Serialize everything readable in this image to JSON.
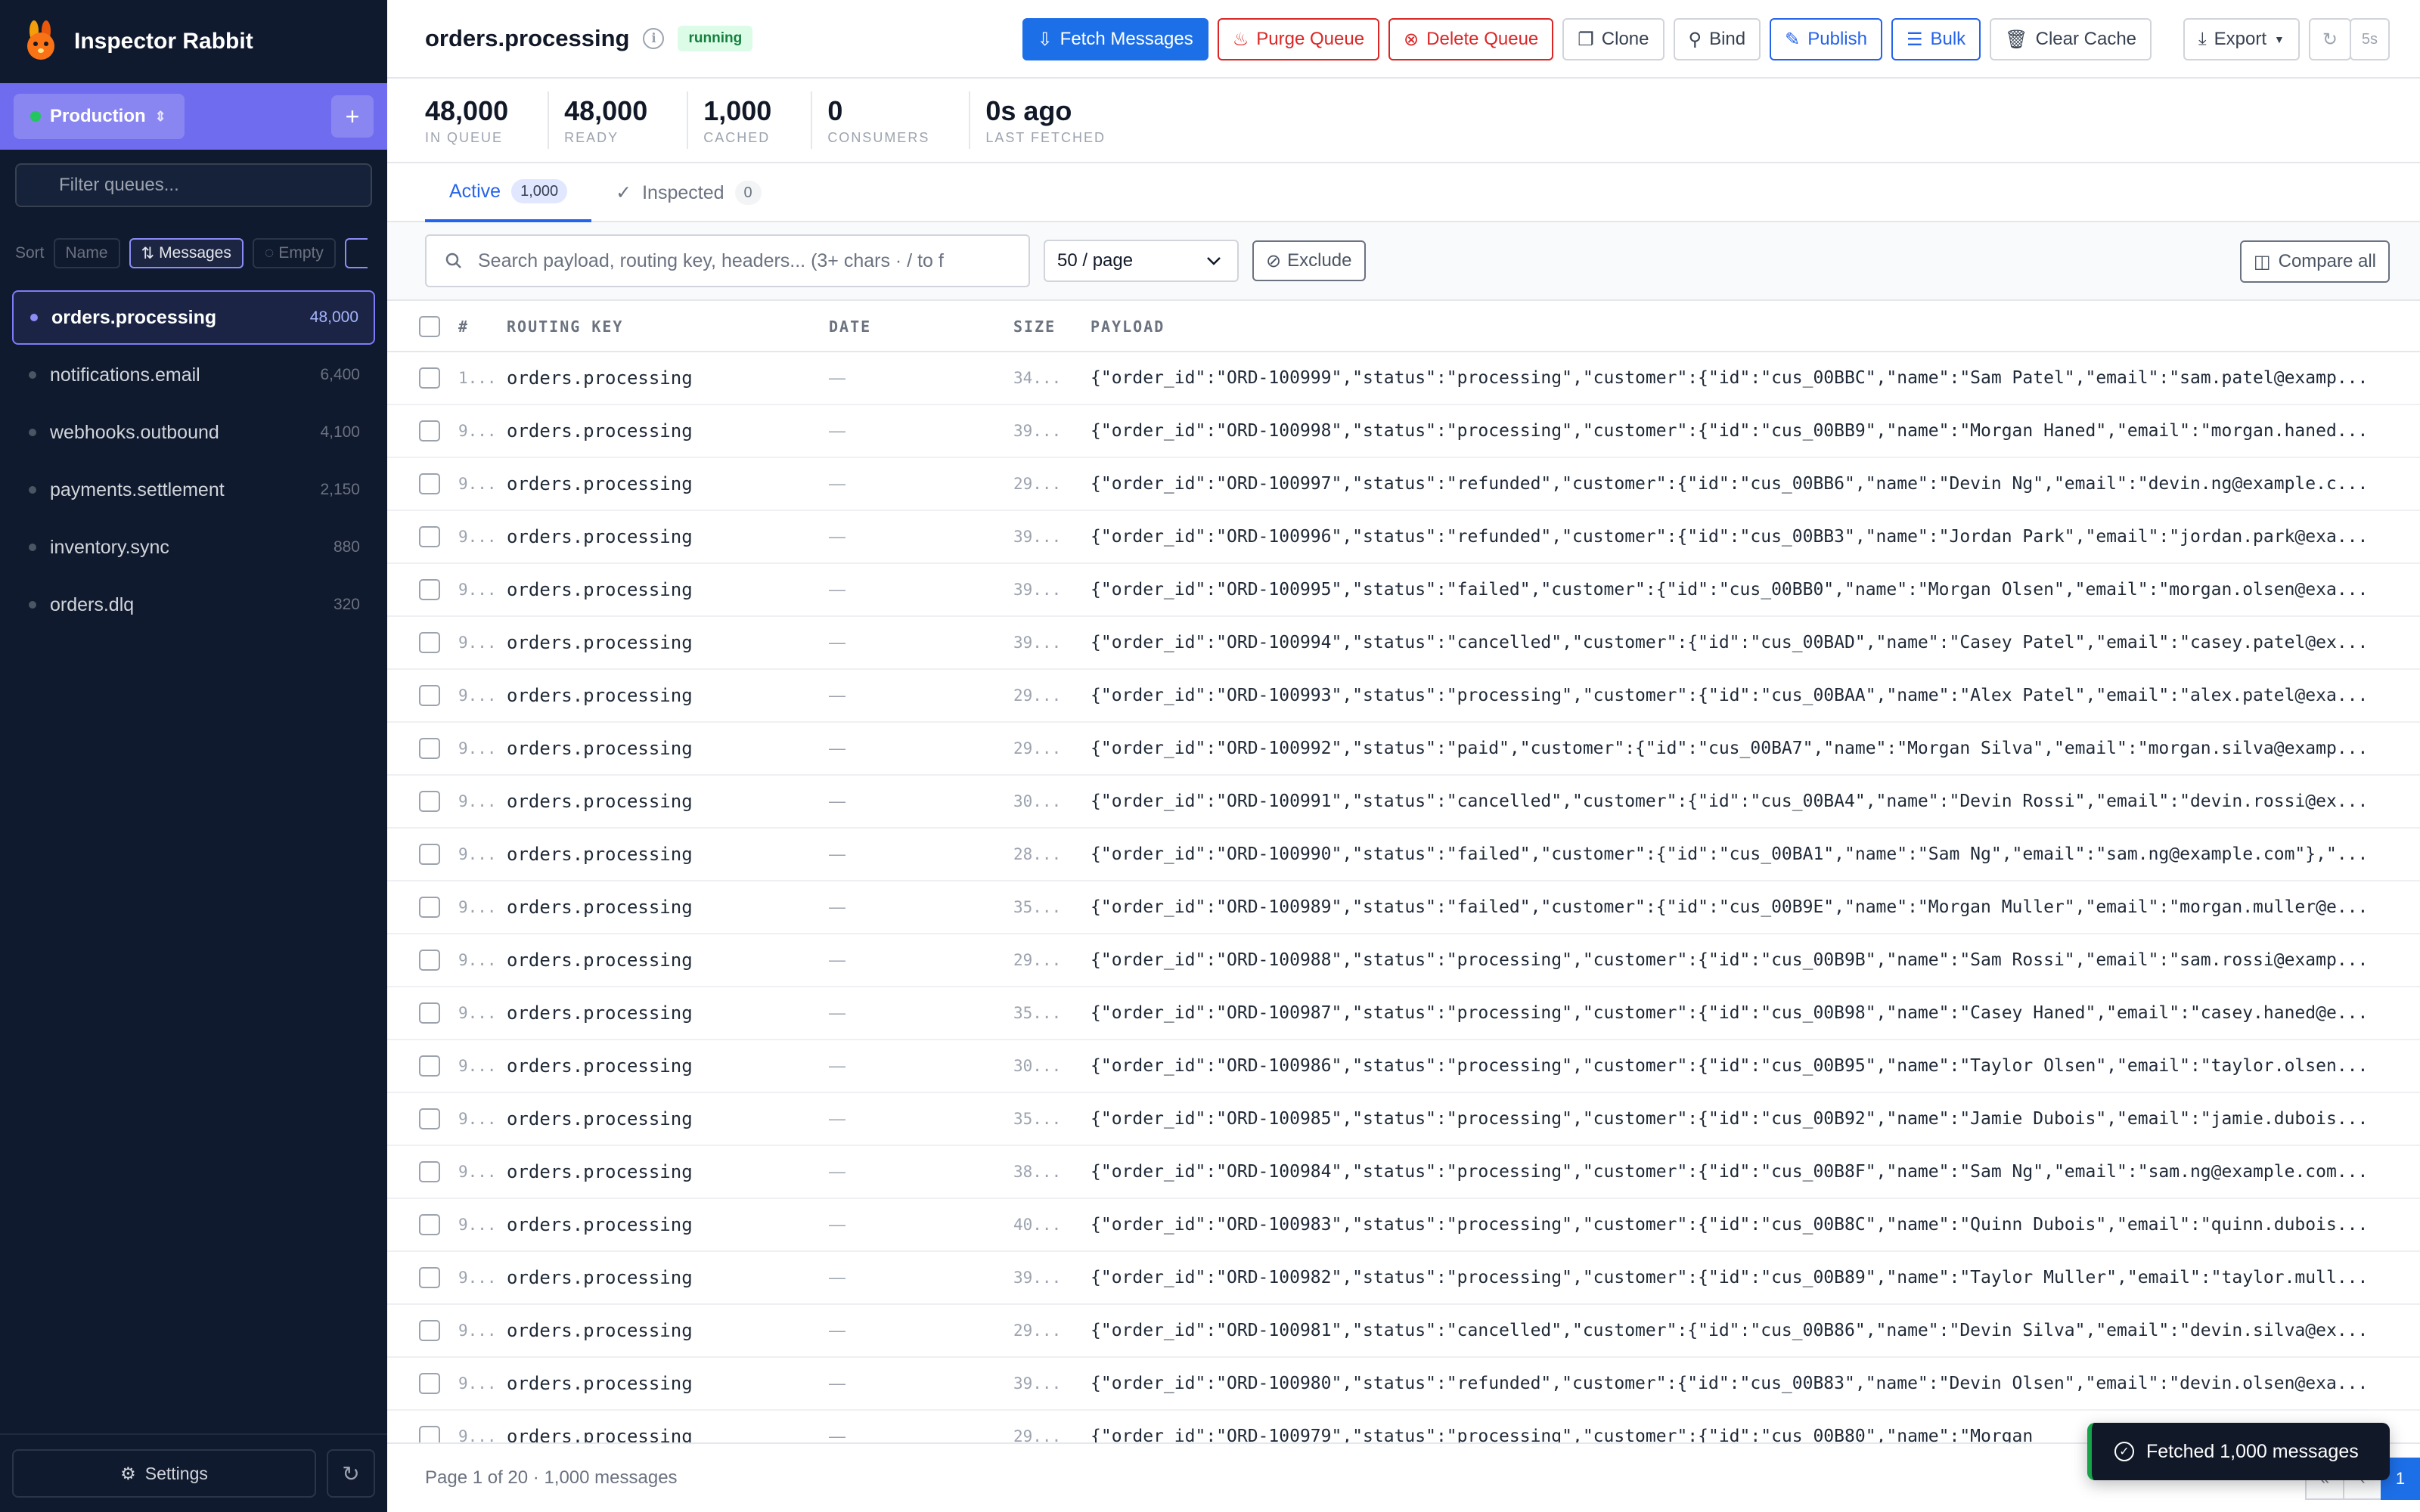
{
  "app": {
    "title": "Inspector Rabbit"
  },
  "sidebar": {
    "environment": "Production",
    "filter_placeholder": "Filter queues...",
    "sort_label": "Sort",
    "sort_options": [
      "Name",
      "Messages",
      "Empty"
    ],
    "queues": [
      {
        "name": "orders.processing",
        "count": "48,000"
      },
      {
        "name": "notifications.email",
        "count": "6,400"
      },
      {
        "name": "webhooks.outbound",
        "count": "4,100"
      },
      {
        "name": "payments.settlement",
        "count": "2,150"
      },
      {
        "name": "inventory.sync",
        "count": "880"
      },
      {
        "name": "orders.dlq",
        "count": "320"
      }
    ],
    "settings_label": "Settings"
  },
  "header": {
    "queue_title": "orders.processing",
    "status": "running",
    "buttons": {
      "fetch": "Fetch Messages",
      "purge": "Purge Queue",
      "delete": "Delete Queue",
      "clone": "Clone",
      "bind": "Bind",
      "publish": "Publish",
      "bulk": "Bulk",
      "clear_cache": "Clear Cache",
      "export": "Export",
      "interval": "5s"
    }
  },
  "stats": [
    {
      "value": "48,000",
      "label": "IN QUEUE"
    },
    {
      "value": "48,000",
      "label": "READY"
    },
    {
      "value": "1,000",
      "label": "CACHED"
    },
    {
      "value": "0",
      "label": "CONSUMERS"
    },
    {
      "value": "0s ago",
      "label": "LAST FETCHED"
    }
  ],
  "tabs": [
    {
      "label": "Active",
      "count": "1,000"
    },
    {
      "label": "Inspected",
      "count": "0"
    }
  ],
  "filters": {
    "search_placeholder": "Search payload, routing key, headers... (3+ chars · / to f",
    "page_size": "50 / page",
    "exclude": "Exclude",
    "compare": "Compare all"
  },
  "table": {
    "headers": {
      "num": "#",
      "routing_key": "ROUTING KEY",
      "date": "DATE",
      "size": "SIZE",
      "payload": "PAYLOAD"
    },
    "rows": [
      {
        "num": "1...",
        "rk": "orders.processing",
        "date": "—",
        "size": "34...",
        "payload": "{\"order_id\":\"ORD-100999\",\"status\":\"processing\",\"customer\":{\"id\":\"cus_00BBC\",\"name\":\"Sam Patel\",\"email\":\"sam.patel@examp..."
      },
      {
        "num": "9...",
        "rk": "orders.processing",
        "date": "—",
        "size": "39...",
        "payload": "{\"order_id\":\"ORD-100998\",\"status\":\"processing\",\"customer\":{\"id\":\"cus_00BB9\",\"name\":\"Morgan Haned\",\"email\":\"morgan.haned..."
      },
      {
        "num": "9...",
        "rk": "orders.processing",
        "date": "—",
        "size": "29...",
        "payload": "{\"order_id\":\"ORD-100997\",\"status\":\"refunded\",\"customer\":{\"id\":\"cus_00BB6\",\"name\":\"Devin Ng\",\"email\":\"devin.ng@example.c..."
      },
      {
        "num": "9...",
        "rk": "orders.processing",
        "date": "—",
        "size": "39...",
        "payload": "{\"order_id\":\"ORD-100996\",\"status\":\"refunded\",\"customer\":{\"id\":\"cus_00BB3\",\"name\":\"Jordan Park\",\"email\":\"jordan.park@exa..."
      },
      {
        "num": "9...",
        "rk": "orders.processing",
        "date": "—",
        "size": "39...",
        "payload": "{\"order_id\":\"ORD-100995\",\"status\":\"failed\",\"customer\":{\"id\":\"cus_00BB0\",\"name\":\"Morgan Olsen\",\"email\":\"morgan.olsen@exa..."
      },
      {
        "num": "9...",
        "rk": "orders.processing",
        "date": "—",
        "size": "39...",
        "payload": "{\"order_id\":\"ORD-100994\",\"status\":\"cancelled\",\"customer\":{\"id\":\"cus_00BAD\",\"name\":\"Casey Patel\",\"email\":\"casey.patel@ex..."
      },
      {
        "num": "9...",
        "rk": "orders.processing",
        "date": "—",
        "size": "29...",
        "payload": "{\"order_id\":\"ORD-100993\",\"status\":\"processing\",\"customer\":{\"id\":\"cus_00BAA\",\"name\":\"Alex Patel\",\"email\":\"alex.patel@exa..."
      },
      {
        "num": "9...",
        "rk": "orders.processing",
        "date": "—",
        "size": "29...",
        "payload": "{\"order_id\":\"ORD-100992\",\"status\":\"paid\",\"customer\":{\"id\":\"cus_00BA7\",\"name\":\"Morgan Silva\",\"email\":\"morgan.silva@examp..."
      },
      {
        "num": "9...",
        "rk": "orders.processing",
        "date": "—",
        "size": "30...",
        "payload": "{\"order_id\":\"ORD-100991\",\"status\":\"cancelled\",\"customer\":{\"id\":\"cus_00BA4\",\"name\":\"Devin Rossi\",\"email\":\"devin.rossi@ex..."
      },
      {
        "num": "9...",
        "rk": "orders.processing",
        "date": "—",
        "size": "28...",
        "payload": "{\"order_id\":\"ORD-100990\",\"status\":\"failed\",\"customer\":{\"id\":\"cus_00BA1\",\"name\":\"Sam Ng\",\"email\":\"sam.ng@example.com\"},\"..."
      },
      {
        "num": "9...",
        "rk": "orders.processing",
        "date": "—",
        "size": "35...",
        "payload": "{\"order_id\":\"ORD-100989\",\"status\":\"failed\",\"customer\":{\"id\":\"cus_00B9E\",\"name\":\"Morgan Muller\",\"email\":\"morgan.muller@e..."
      },
      {
        "num": "9...",
        "rk": "orders.processing",
        "date": "—",
        "size": "29...",
        "payload": "{\"order_id\":\"ORD-100988\",\"status\":\"processing\",\"customer\":{\"id\":\"cus_00B9B\",\"name\":\"Sam Rossi\",\"email\":\"sam.rossi@examp..."
      },
      {
        "num": "9...",
        "rk": "orders.processing",
        "date": "—",
        "size": "35...",
        "payload": "{\"order_id\":\"ORD-100987\",\"status\":\"processing\",\"customer\":{\"id\":\"cus_00B98\",\"name\":\"Casey Haned\",\"email\":\"casey.haned@e..."
      },
      {
        "num": "9...",
        "rk": "orders.processing",
        "date": "—",
        "size": "30...",
        "payload": "{\"order_id\":\"ORD-100986\",\"status\":\"processing\",\"customer\":{\"id\":\"cus_00B95\",\"name\":\"Taylor Olsen\",\"email\":\"taylor.olsen..."
      },
      {
        "num": "9...",
        "rk": "orders.processing",
        "date": "—",
        "size": "35...",
        "payload": "{\"order_id\":\"ORD-100985\",\"status\":\"processing\",\"customer\":{\"id\":\"cus_00B92\",\"name\":\"Jamie Dubois\",\"email\":\"jamie.dubois..."
      },
      {
        "num": "9...",
        "rk": "orders.processing",
        "date": "—",
        "size": "38...",
        "payload": "{\"order_id\":\"ORD-100984\",\"status\":\"processing\",\"customer\":{\"id\":\"cus_00B8F\",\"name\":\"Sam Ng\",\"email\":\"sam.ng@example.com..."
      },
      {
        "num": "9...",
        "rk": "orders.processing",
        "date": "—",
        "size": "40...",
        "payload": "{\"order_id\":\"ORD-100983\",\"status\":\"processing\",\"customer\":{\"id\":\"cus_00B8C\",\"name\":\"Quinn Dubois\",\"email\":\"quinn.dubois..."
      },
      {
        "num": "9...",
        "rk": "orders.processing",
        "date": "—",
        "size": "39...",
        "payload": "{\"order_id\":\"ORD-100982\",\"status\":\"processing\",\"customer\":{\"id\":\"cus_00B89\",\"name\":\"Taylor Muller\",\"email\":\"taylor.mull..."
      },
      {
        "num": "9...",
        "rk": "orders.processing",
        "date": "—",
        "size": "29...",
        "payload": "{\"order_id\":\"ORD-100981\",\"status\":\"cancelled\",\"customer\":{\"id\":\"cus_00B86\",\"name\":\"Devin Silva\",\"email\":\"devin.silva@ex..."
      },
      {
        "num": "9...",
        "rk": "orders.processing",
        "date": "—",
        "size": "39...",
        "payload": "{\"order_id\":\"ORD-100980\",\"status\":\"refunded\",\"customer\":{\"id\":\"cus_00B83\",\"name\":\"Devin Olsen\",\"email\":\"devin.olsen@exa..."
      },
      {
        "num": "9...",
        "rk": "orders.processing",
        "date": "—",
        "size": "29...",
        "payload": "{\"order_id\":\"ORD-100979\",\"status\":\"processing\",\"customer\":{\"id\":\"cus_00B80\",\"name\":\"Morgan"
      }
    ]
  },
  "footer": {
    "summary": "Page 1 of 20 · 1,000 messages",
    "current_page": "1"
  },
  "toast": {
    "message": "Fetched 1,000 messages"
  },
  "colors": {
    "accent": "#1d6fe8",
    "sidebar_bg": "#101a2e",
    "env_bar": "#6f6cf0",
    "danger": "#dc2626",
    "success": "#16a34a"
  },
  "icons": [
    "rabbit-logo",
    "chevrons-updown-icon",
    "plus-icon",
    "search-icon",
    "sort-icon",
    "eye-off-icon",
    "gear-icon",
    "refresh-icon",
    "info-icon",
    "download-cloud-icon",
    "flame-icon",
    "x-circle-icon",
    "copy-icon",
    "bind-icon",
    "edit-icon",
    "layers-icon",
    "trash-icon",
    "check-circle-icon",
    "columns-icon"
  ]
}
